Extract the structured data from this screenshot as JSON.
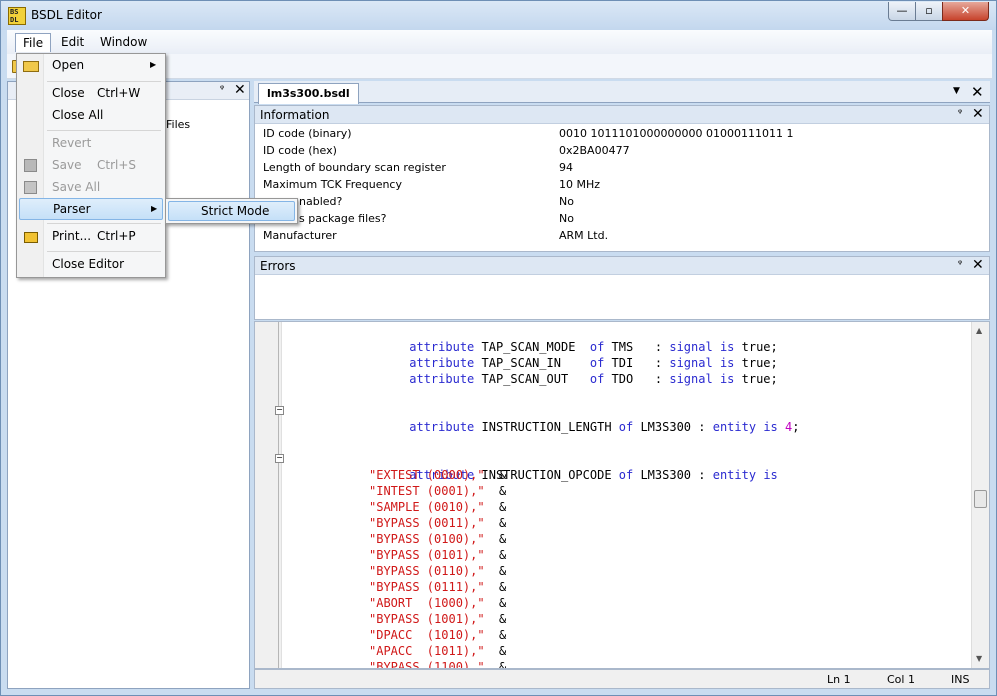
{
  "window": {
    "title": "BSDL Editor",
    "app_icon_text": "BS DL",
    "minimize": "—",
    "maximize": "▫",
    "close": "✕"
  },
  "menubar": {
    "file": "File",
    "edit": "Edit",
    "window": "Window"
  },
  "file_menu": {
    "open": "Open",
    "close": "Close",
    "close_shortcut": "Ctrl+W",
    "close_all": "Close All",
    "revert": "Revert",
    "save": "Save",
    "save_shortcut": "Ctrl+S",
    "save_all": "Save All",
    "parser": "Parser",
    "print": "Print...",
    "print_shortcut": "Ctrl+P",
    "close_editor": "Close Editor"
  },
  "parser_submenu": {
    "strict_mode": "Strict Mode"
  },
  "left_panel": {
    "pin": "ᵠ",
    "close": "✕",
    "files_label": "Files"
  },
  "document": {
    "tab_label": "lm3s300.bsdl",
    "tab_dropdown": "▼",
    "tab_close": "✕"
  },
  "info_panel": {
    "title": "Information",
    "pin": "ᵠ",
    "close": "✕",
    "rows": [
      {
        "key": "ID code (binary)",
        "value": "0010 1011101000000000 01000111011 1"
      },
      {
        "key": "ID code (hex)",
        "value": "0x2BA00477"
      },
      {
        "key": "Length of boundary scan register",
        "value": "94"
      },
      {
        "key": "Maximum TCK Frequency",
        "value": "10 MHz"
      },
      {
        "key": "nabled?",
        "value": "No"
      },
      {
        "key": "s package files?",
        "value": "No"
      },
      {
        "key": "Manufacturer",
        "value": "ARM Ltd."
      }
    ]
  },
  "errors_panel": {
    "title": "Errors",
    "pin": "ᵠ",
    "close": "✕"
  },
  "code": {
    "lines": [
      [
        "attribute",
        " TAP_SCAN_MODE  ",
        "of",
        " TMS   : ",
        "signal",
        " ",
        "is",
        " true;"
      ],
      [
        "attribute",
        " TAP_SCAN_IN    ",
        "of",
        " TDI   : ",
        "signal",
        " ",
        "is",
        " true;"
      ],
      [
        "attribute",
        " TAP_SCAN_OUT   ",
        "of",
        " TDO   : ",
        "signal",
        " ",
        "is",
        " true;"
      ]
    ],
    "instr_length": {
      "kw1": "attribute",
      "t1": " INSTRUCTION_LENGTH ",
      "kw2": "of",
      "t2": " LM3S300 : ",
      "kw3": "entity",
      "t3": " ",
      "kw4": "is",
      "t4": " ",
      "num": "4",
      "t5": ";"
    },
    "instr_opcode": {
      "kw1": "attribute",
      "t1": " INSTRUCTION_OPCODE ",
      "kw2": "of",
      "t2": " LM3S300 : ",
      "kw3": "entity",
      "t3": " ",
      "kw4": "is"
    },
    "opcodes": [
      {
        "s": "\"EXTEST (0000),\"",
        "amp": "  &"
      },
      {
        "s": "\"INTEST (0001),\"",
        "amp": "  &"
      },
      {
        "s": "\"SAMPLE (0010),\"",
        "amp": "  &"
      },
      {
        "s": "\"BYPASS (0011),\"",
        "amp": "  &"
      },
      {
        "s": "\"BYPASS (0100),\"",
        "amp": "  &"
      },
      {
        "s": "\"BYPASS (0101),\"",
        "amp": "  &"
      },
      {
        "s": "\"BYPASS (0110),\"",
        "amp": "  &"
      },
      {
        "s": "\"BYPASS (0111),\"",
        "amp": "  &"
      },
      {
        "s": "\"ABORT  (1000),\"",
        "amp": "  &"
      },
      {
        "s": "\"BYPASS (1001),\"",
        "amp": "  &"
      },
      {
        "s": "\"DPACC  (1010),\"",
        "amp": "  &"
      },
      {
        "s": "\"APACC  (1011),\"",
        "amp": "  &"
      },
      {
        "s": "\"BYPASS (1100),\"",
        "amp": "  &"
      }
    ],
    "fold_symbol": "−"
  },
  "scrollbar": {
    "up": "▲",
    "down": "▼"
  },
  "statusbar": {
    "line": "Ln 1",
    "col": "Col 1",
    "mode": "INS"
  }
}
